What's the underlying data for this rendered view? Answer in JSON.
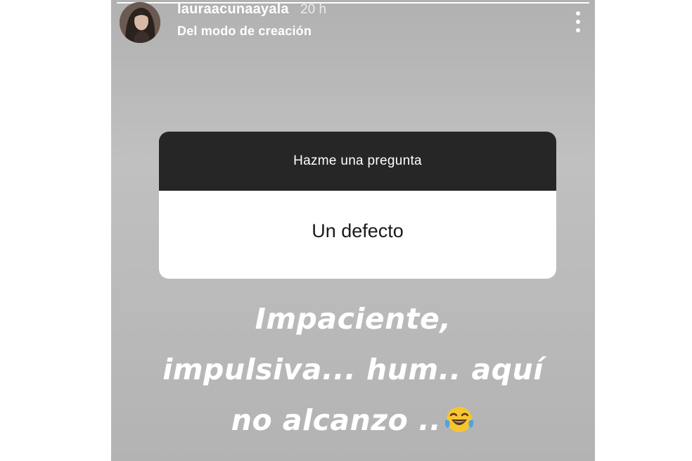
{
  "story": {
    "progress": 1.0,
    "username": "lauraacunaayala",
    "time": "20 h",
    "subtitle": "Del modo de creación",
    "menu_icon": "more-vertical-icon",
    "avatar_icon": "profile-photo"
  },
  "question_sticker": {
    "prompt": "Hazme una pregunta",
    "answer": "Un defecto"
  },
  "caption": {
    "line1": "Impaciente,",
    "line2": "impulsiva... hum.. aquí",
    "line3": "no alcanzo ..",
    "emoji": "face-with-tears-of-joy-icon"
  },
  "colors": {
    "background": "#b9b9b9",
    "sticker_header": "#262626",
    "sticker_body": "#ffffff",
    "text": "#ffffff"
  }
}
